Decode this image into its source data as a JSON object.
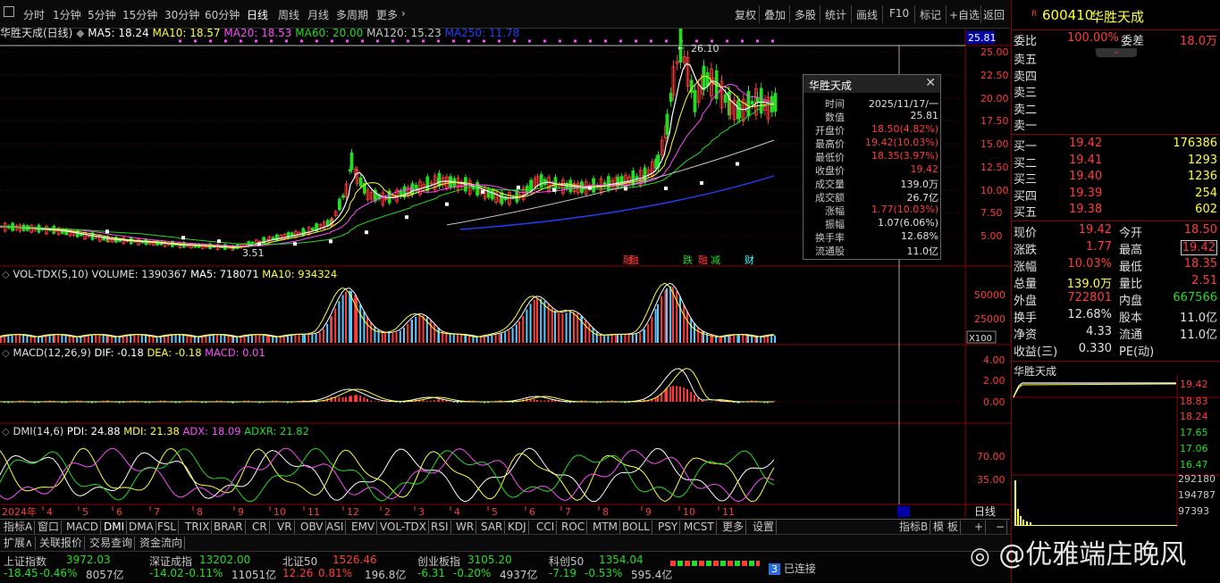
{
  "toolbar": {
    "periods": [
      "分时",
      "1分钟",
      "5分钟",
      "15分钟",
      "30分钟",
      "60分钟",
      "日线",
      "周线",
      "月线",
      "多周期",
      "更多"
    ],
    "actions": [
      "复权",
      "叠加",
      "多股",
      "统计",
      "画线",
      "F10",
      "标记",
      "+自选",
      "返回"
    ]
  },
  "ma_line": {
    "title": "华胜天成(日线)",
    "ma5": "MA5: 18.24",
    "ma10": "MA10: 18.57",
    "ma20": "MA20: 18.53",
    "ma60": "MA60: 20.00",
    "ma120": "MA120: 15.23",
    "ma250": "MA250: 11.78"
  },
  "price_axis": {
    "labels": [
      "25.00",
      "22.50",
      "20.00",
      "17.50",
      "15.00",
      "12.50",
      "10.00",
      "7.50",
      "5.00"
    ],
    "current": "25.81"
  },
  "annotations": {
    "high": "26.10",
    "low": "3.51",
    "events": [
      "融",
      "跌",
      "融",
      "减",
      "财"
    ]
  },
  "volume_panel": {
    "label": "VOL-TDX(5,10)",
    "volume": "VOLUME: 1390367",
    "ma5": "MA5: 718071",
    "ma10": "MA10: 934324",
    "axis": [
      "50000",
      "25000"
    ],
    "unit": "X100"
  },
  "macd_panel": {
    "label": "MACD(12,26,9)",
    "dif": "DIF: -0.18",
    "dea": "DEA: -0.18",
    "macd": "MACD: 0.01",
    "axis": [
      "4.00",
      "2.00",
      "0.00"
    ]
  },
  "dmi_panel": {
    "label": "DMI(14,6)",
    "pdi": "PDI: 24.88",
    "mdi": "MDI: 21.38",
    "adx": "ADX: 18.09",
    "adxr": "ADXR: 21.82",
    "axis": [
      "70.00",
      "35.00"
    ]
  },
  "time_axis": {
    "year": "2024年",
    "months": [
      "4",
      "5",
      "6",
      "7",
      "8",
      "9",
      "10",
      "11",
      "12",
      "2",
      "3",
      "4",
      "5",
      "6",
      "7",
      "8",
      "9",
      "10",
      "11"
    ],
    "right_label": "日线"
  },
  "indicator_tabs": [
    "指标A",
    "窗口",
    "MACD",
    "DMI",
    "DMA",
    "FSL",
    "TRIX",
    "BRAR",
    "CR",
    "VR",
    "OBV",
    "ASI",
    "EMV",
    "VOL-TDX",
    "RSI",
    "WR",
    "SAR",
    "KDJ",
    "CCI",
    "ROC",
    "MTM",
    "BOLL",
    "PSY",
    "MCST",
    "更多",
    "设置"
  ],
  "indicator_tabs_right": [
    "指标B",
    "模 板",
    "+",
    "−"
  ],
  "bottom_tabs": [
    "扩展∧",
    "关联报价",
    "交易查询",
    "资金流向"
  ],
  "info_box": {
    "title": "华胜天成",
    "rows": [
      {
        "k": "时间",
        "v": "2025/11/17/一",
        "c": "white"
      },
      {
        "k": "数值",
        "v": "25.81",
        "c": "white"
      },
      {
        "k": "开盘价",
        "v": "18.50(4.82%)",
        "c": "red"
      },
      {
        "k": "最高价",
        "v": "19.42(10.03%)",
        "c": "red"
      },
      {
        "k": "最低价",
        "v": "18.35(3.97%)",
        "c": "red"
      },
      {
        "k": "收盘价",
        "v": "19.42",
        "c": "red"
      },
      {
        "k": "成交量",
        "v": "139.0万",
        "c": "white"
      },
      {
        "k": "成交额",
        "v": "26.7亿",
        "c": "white"
      },
      {
        "k": "涨幅",
        "v": "1.77(10.03%)",
        "c": "red"
      },
      {
        "k": "振幅",
        "v": "1.07(6.06%)",
        "c": "white"
      },
      {
        "k": "换手率",
        "v": "12.68%",
        "c": "white"
      },
      {
        "k": "流通股",
        "v": "11.0亿",
        "c": "white"
      }
    ]
  },
  "quote": {
    "code": "600410",
    "name": "华胜天成",
    "badge": "R",
    "weibi_label": "委比",
    "weibi": "100.00%",
    "weicha_label": "委差",
    "weicha": "18.0万",
    "sells": [
      "卖五",
      "卖四",
      "卖三",
      "卖二",
      "卖一"
    ],
    "buys": [
      {
        "l": "买一",
        "p": "19.42",
        "v": "176386"
      },
      {
        "l": "买二",
        "p": "19.41",
        "v": "1293"
      },
      {
        "l": "买三",
        "p": "19.40",
        "v": "1236"
      },
      {
        "l": "买四",
        "p": "19.39",
        "v": "254"
      },
      {
        "l": "买五",
        "p": "19.38",
        "v": "602"
      }
    ],
    "stats": [
      {
        "l1": "现价",
        "v1": "19.42",
        "c1": "red",
        "l2": "今开",
        "v2": "18.50",
        "c2": "red"
      },
      {
        "l1": "涨跌",
        "v1": "1.77",
        "c1": "red",
        "l2": "最高",
        "v2": "19.42",
        "c2": "red"
      },
      {
        "l1": "涨幅",
        "v1": "10.03%",
        "c1": "red",
        "l2": "最低",
        "v2": "18.35",
        "c2": "red"
      },
      {
        "l1": "总量",
        "v1": "139.0万",
        "c1": "yellow",
        "l2": "量比",
        "v2": "2.51",
        "c2": "red"
      },
      {
        "l1": "外盘",
        "v1": "722801",
        "c1": "red",
        "l2": "内盘",
        "v2": "667566",
        "c2": "green"
      },
      {
        "l1": "换手",
        "v1": "12.68%",
        "c1": "white",
        "l2": "股本",
        "v2": "11.0亿",
        "c2": "white"
      },
      {
        "l1": "净资",
        "v1": "4.33",
        "c1": "white",
        "l2": "流通",
        "v2": "11.0亿",
        "c2": "white"
      },
      {
        "l1": "收益(三)",
        "v1": "0.330",
        "c1": "white",
        "l2": "PE(动)",
        "v2": "",
        "c2": "white"
      }
    ],
    "mini_title": "华胜天成",
    "mini_axis": [
      "19.42",
      "18.83",
      "18.24",
      "17.65",
      "17.06",
      "16.47"
    ],
    "mini_vol_axis": [
      "292180",
      "194787",
      "97393"
    ]
  },
  "status_bar": [
    {
      "name": "上证指数",
      "val": "3972.03",
      "chg": "-18.45",
      "pct": "-0.46%",
      "amt": "8057亿"
    },
    {
      "name": "深证成指",
      "val": "13202.00",
      "chg": "-14.02",
      "pct": "-0.11%",
      "amt": "11051亿"
    },
    {
      "name": "北证50",
      "val": "1526.46",
      "chg": "12.26",
      "pct": "0.81%",
      "amt": "196.8亿"
    },
    {
      "name": "创业板指",
      "val": "3105.20",
      "chg": "-6.31",
      "pct": "-0.20%",
      "amt": "4937亿"
    },
    {
      "name": "科创50",
      "val": "1354.04",
      "chg": "-7.19",
      "pct": "-0.53%",
      "amt": "595.4亿"
    }
  ],
  "connection": {
    "badge": "3",
    "text": "已连接"
  },
  "watermark": "@优雅端庄晚风",
  "colors": {
    "up": "#ff3c3c",
    "down": "#22dd22",
    "ma5": "#ffffff",
    "ma10": "#ffff3c",
    "ma20": "#ff4cff",
    "ma60": "#22dd22",
    "ma120": "#c8c8c8",
    "ma250": "#2040ff"
  }
}
